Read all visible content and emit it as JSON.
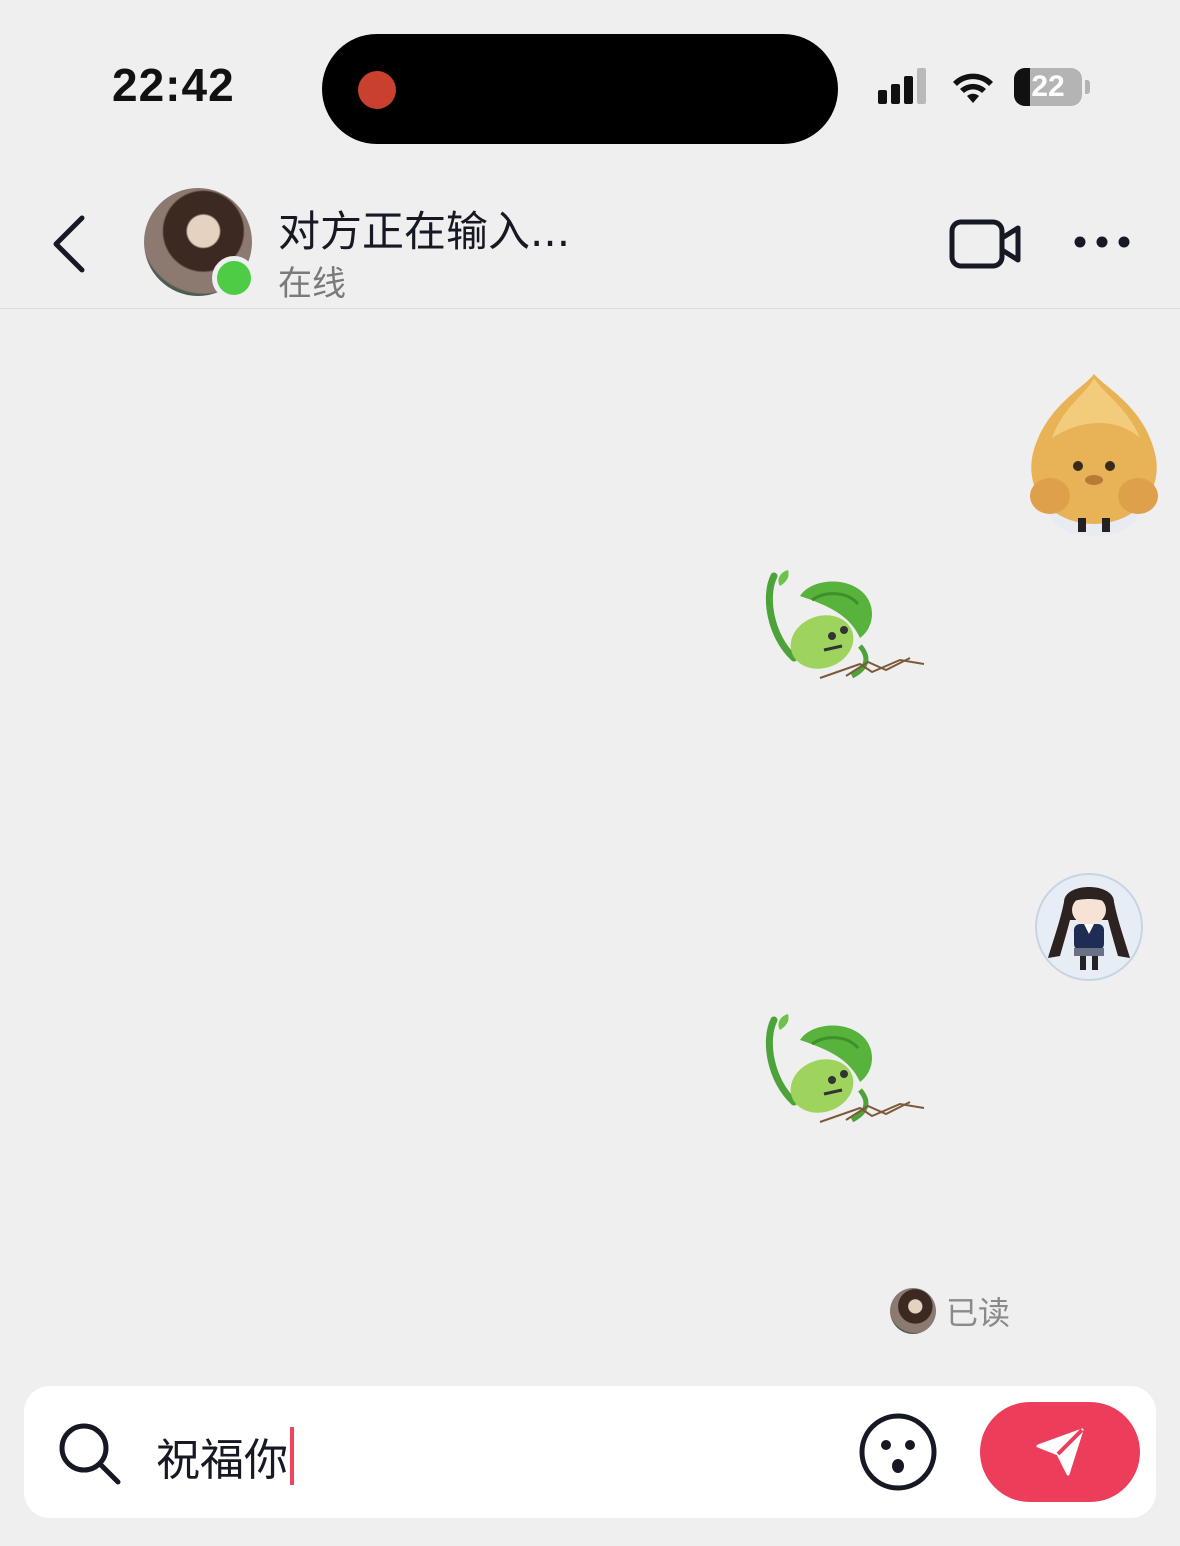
{
  "status_bar": {
    "time": "22:42",
    "battery_level": "22"
  },
  "header": {
    "title": "对方正在输入...",
    "status": "在线",
    "icons": {
      "back": "chevron-left-icon",
      "video": "video-camera-icon",
      "more": "more-dots-icon"
    }
  },
  "messages": [
    {
      "sender": "self",
      "type": "sticker",
      "sticker": "yellow-blob-character"
    },
    {
      "sender": "self",
      "type": "sticker",
      "sticker": "bok-choy-plant"
    },
    {
      "sender": "self",
      "type": "sticker",
      "sticker": "anime-girl-avatar"
    },
    {
      "sender": "self",
      "type": "sticker",
      "sticker": "bok-choy-plant"
    }
  ],
  "read_receipt": {
    "label": "已读"
  },
  "composer": {
    "text": "祝福你",
    "icons": {
      "search": "search-icon",
      "emoji": "emoji-icon",
      "send": "send-icon"
    }
  },
  "colors": {
    "background": "#efefef",
    "online": "#4fcc46",
    "send_button": "#ec3d5a",
    "recording_dot": "#c9402f"
  }
}
